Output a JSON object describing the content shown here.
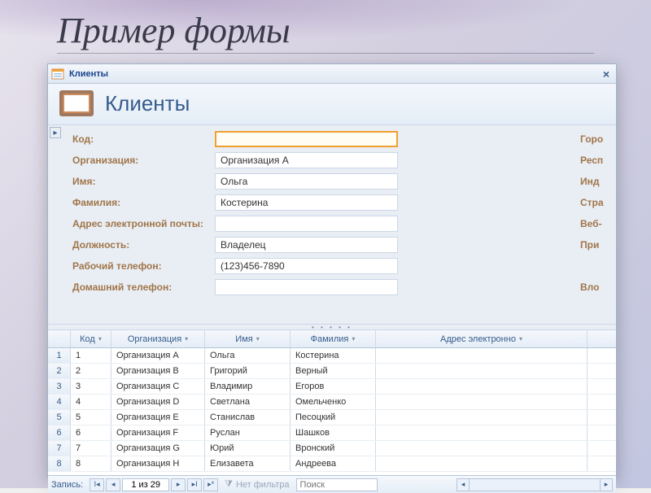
{
  "slide_title": "Пример формы",
  "tab": {
    "label": "Клиенты"
  },
  "header": {
    "title": "Клиенты"
  },
  "fields": [
    {
      "label": "Код:",
      "value": "",
      "right": "Горо",
      "focus": true
    },
    {
      "label": "Организация:",
      "value": "Организация А",
      "right": "Респ"
    },
    {
      "label": "Имя:",
      "value": "Ольга",
      "right": "Инд"
    },
    {
      "label": "Фамилия:",
      "value": "Костерина",
      "right": "Стра"
    },
    {
      "label": "Адрес электронной почты:",
      "value": "",
      "right": "Веб-"
    },
    {
      "label": "Должность:",
      "value": "Владелец",
      "right": "При"
    },
    {
      "label": "Рабочий телефон:",
      "value": "(123)456-7890",
      "right": ""
    },
    {
      "label": "Домашний телефон:",
      "value": "",
      "right": "Вло"
    }
  ],
  "datasheet": {
    "columns": [
      "Код",
      "Организация",
      "Имя",
      "Фамилия",
      "Адрес электронно"
    ],
    "rows": [
      {
        "id": "1",
        "org": "Организация А",
        "name": "Ольга",
        "fam": "Костерина",
        "email": ""
      },
      {
        "id": "2",
        "org": "Организация В",
        "name": "Григорий",
        "fam": "Верный",
        "email": ""
      },
      {
        "id": "3",
        "org": "Организация С",
        "name": "Владимир",
        "fam": "Егоров",
        "email": ""
      },
      {
        "id": "4",
        "org": "Организация D",
        "name": "Светлана",
        "fam": "Омельченко",
        "email": ""
      },
      {
        "id": "5",
        "org": "Организация Е",
        "name": "Станислав",
        "fam": "Песоцкий",
        "email": ""
      },
      {
        "id": "6",
        "org": "Организация F",
        "name": "Руслан",
        "fam": "Шашков",
        "email": ""
      },
      {
        "id": "7",
        "org": "Организация G",
        "name": "Юрий",
        "fam": "Вронский",
        "email": ""
      },
      {
        "id": "8",
        "org": "Организация Н",
        "name": "Елизавета",
        "fam": "Андреева",
        "email": ""
      }
    ]
  },
  "nav": {
    "label": "Запись:",
    "position": "1 из 29",
    "filter_label": "Нет фильтра",
    "search_placeholder": "Поиск"
  }
}
